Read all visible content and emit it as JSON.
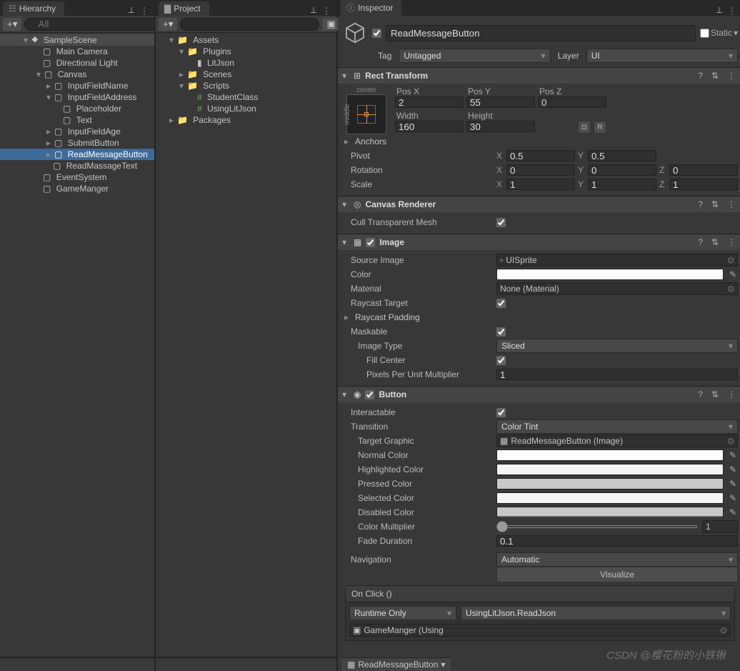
{
  "hierarchy": {
    "title": "Hierarchy",
    "search_placeholder": "All",
    "scene": "SampleScene",
    "items": [
      "Main Camera",
      "Directional Light",
      "Canvas",
      "InputFieldName",
      "InputFieldAddress",
      "Placeholder",
      "Text",
      "InputFieldAge",
      "SubmitButton",
      "ReadMessageButton",
      "ReadMassageText",
      "EventSystem",
      "GameManger"
    ]
  },
  "project": {
    "title": "Project",
    "layer_count": "9",
    "items": [
      "Assets",
      "Plugins",
      "LitJson",
      "Scenes",
      "Scripts",
      "StudentClass",
      "UsingLitJson",
      "Packages"
    ]
  },
  "inspector": {
    "title": "Inspector",
    "name": "ReadMessageButton",
    "static_label": "Static",
    "tag_label": "Tag",
    "tag_value": "Untagged",
    "layer_label": "Layer",
    "layer_value": "UI",
    "rect": {
      "title": "Rect Transform",
      "anchor_h": "center",
      "anchor_v": "middle",
      "posx_l": "Pos X",
      "posy_l": "Pos Y",
      "posz_l": "Pos Z",
      "posx": "2",
      "posy": "55",
      "posz": "0",
      "width_l": "Width",
      "height_l": "Height",
      "width": "160",
      "height": "30",
      "anchors": "Anchors",
      "pivot": "Pivot",
      "pivot_x": "0.5",
      "pivot_y": "0.5",
      "rotation": "Rotation",
      "rx": "0",
      "ry": "0",
      "rz": "0",
      "scale": "Scale",
      "sx": "1",
      "sy": "1",
      "sz": "1",
      "r_btn": "R"
    },
    "cr": {
      "title": "Canvas Renderer",
      "cull": "Cull Transparent Mesh"
    },
    "image": {
      "title": "Image",
      "src_l": "Source Image",
      "src": "UISprite",
      "color_l": "Color",
      "mat_l": "Material",
      "mat": "None (Material)",
      "raycast": "Raycast Target",
      "rpad": "Raycast Padding",
      "mask": "Maskable",
      "type_l": "Image Type",
      "type": "Sliced",
      "fill": "Fill Center",
      "ppu_l": "Pixels Per Unit Multiplier",
      "ppu": "1"
    },
    "button": {
      "title": "Button",
      "inter": "Interactable",
      "trans_l": "Transition",
      "trans": "Color Tint",
      "tg_l": "Target Graphic",
      "tg": "ReadMessageButton (Image)",
      "nc": "Normal Color",
      "hc": "Highlighted Color",
      "pc": "Pressed Color",
      "sc": "Selected Color",
      "dc": "Disabled Color",
      "cm_l": "Color Multiplier",
      "cm": "1",
      "fd_l": "Fade Duration",
      "fd": "0.1",
      "nav_l": "Navigation",
      "nav": "Automatic",
      "vis": "Visualize",
      "onclick": "On Click ()",
      "runtime": "Runtime Only",
      "func": "UsingLitJson.ReadJson",
      "objref": "GameManger (Using"
    },
    "crumb": "ReadMessageButton"
  },
  "watermark": "CSDN @樱花粉的小铁锹"
}
